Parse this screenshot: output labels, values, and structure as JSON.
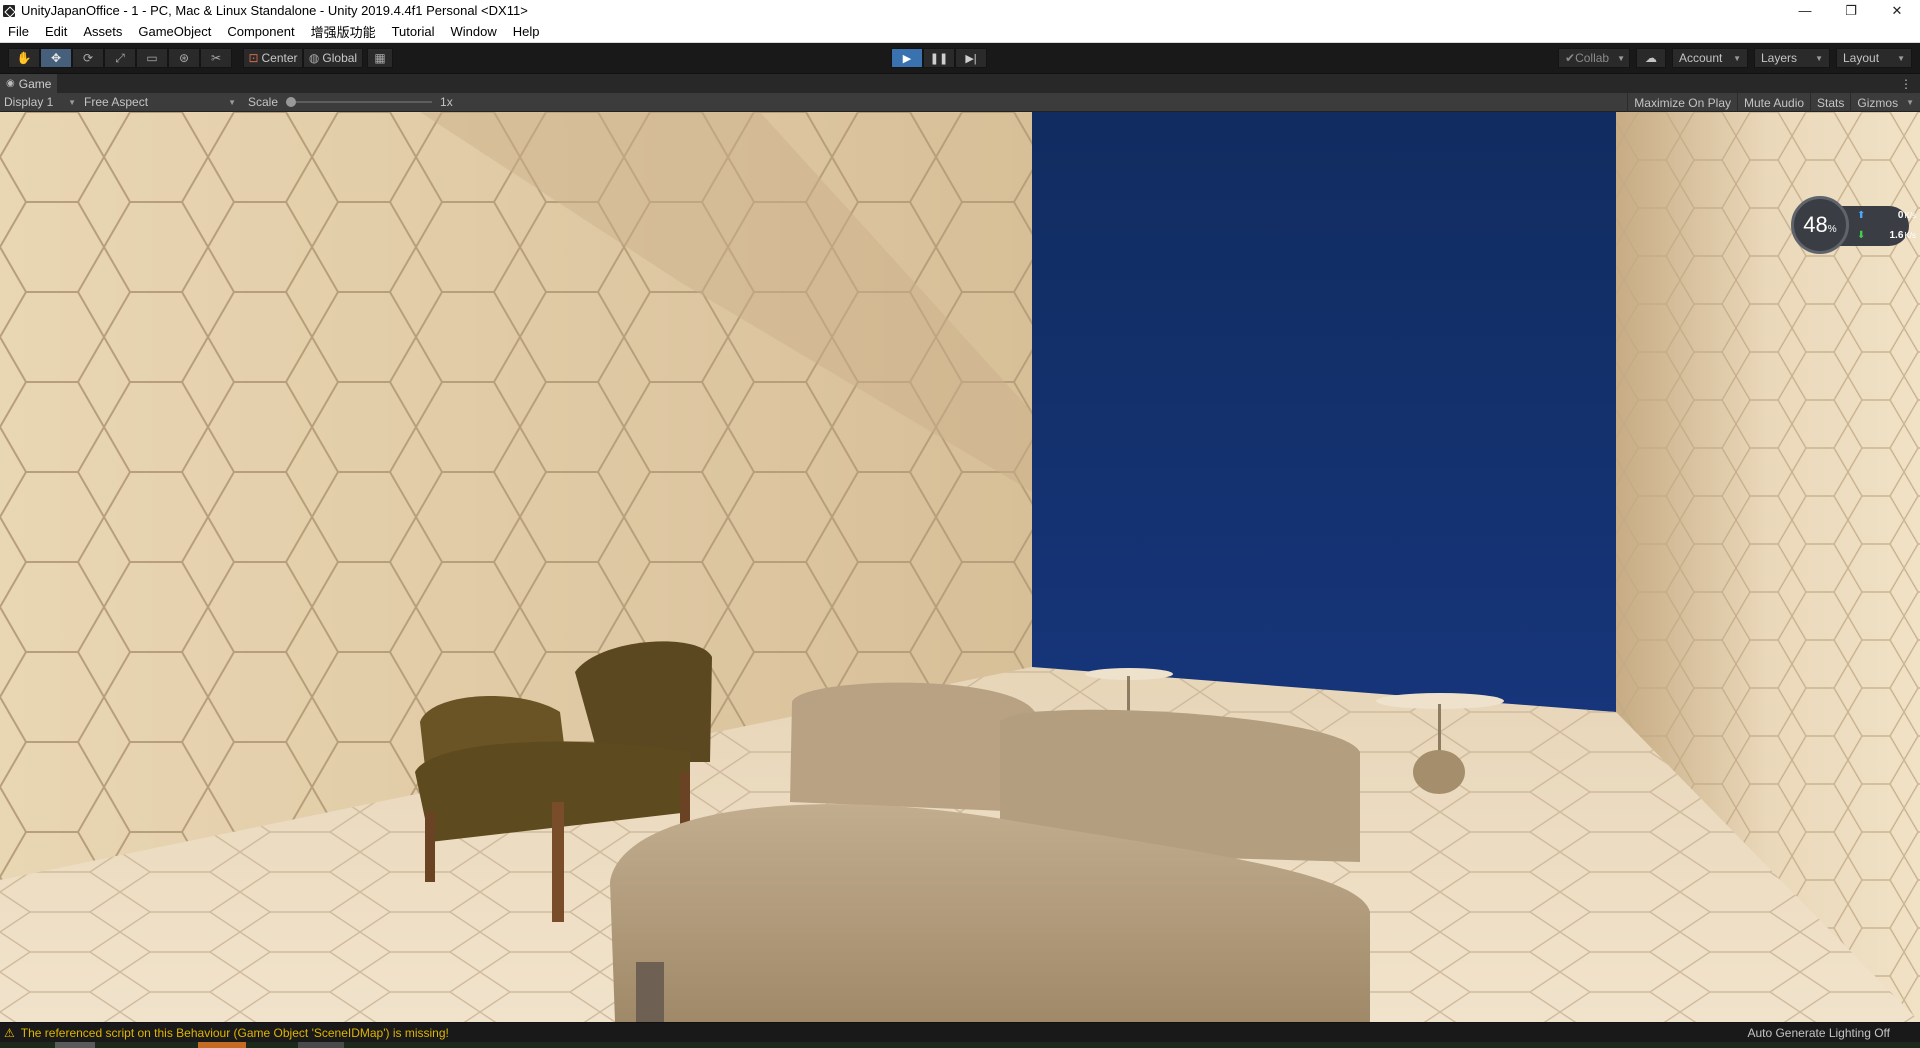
{
  "window": {
    "title": "UnityJapanOffice - 1 - PC, Mac & Linux Standalone - Unity 2019.4.4f1 Personal <DX11>",
    "controls": [
      "—",
      "❐",
      "✕"
    ]
  },
  "menu": [
    "File",
    "Edit",
    "Assets",
    "GameObject",
    "Component",
    "增强版功能",
    "Tutorial",
    "Window",
    "Help"
  ],
  "toolbar": {
    "tools": [
      "hand-icon",
      "move-icon",
      "rotate-icon",
      "scale-icon",
      "rect-icon",
      "transform-icon",
      "custom-tool-icon"
    ],
    "active_tool": "move-icon",
    "pivot_label": "Center",
    "space_label": "Global",
    "play_active": true,
    "collab_label": "Collab",
    "account_label": "Account",
    "layers_label": "Layers",
    "layout_label": "Layout"
  },
  "tab": {
    "label": "Game"
  },
  "game_bar": {
    "display": "Display 1",
    "aspect": "Free Aspect",
    "scale_label": "Scale",
    "scale_value": "1x",
    "maximize": "Maximize On Play",
    "mute": "Mute Audio",
    "stats": "Stats",
    "gizmos": "Gizmos"
  },
  "network_widget": {
    "percent": "48",
    "percent_unit": "%",
    "upload": "0",
    "upload_unit": "K/s",
    "download": "1.6",
    "download_unit": "K/s"
  },
  "status": {
    "warning": "The referenced script on this Behaviour (Game Object 'SceneIDMap') is missing!",
    "right": "Auto Generate Lighting Off"
  },
  "colors": {
    "editor_bg": "#191919",
    "wall": "#e4cfac",
    "backdrop": "#13306a",
    "sofa": "#b39e80",
    "chair": "#5e4a1f",
    "warning": "#e0b400",
    "play_active": "#3a72b0"
  }
}
